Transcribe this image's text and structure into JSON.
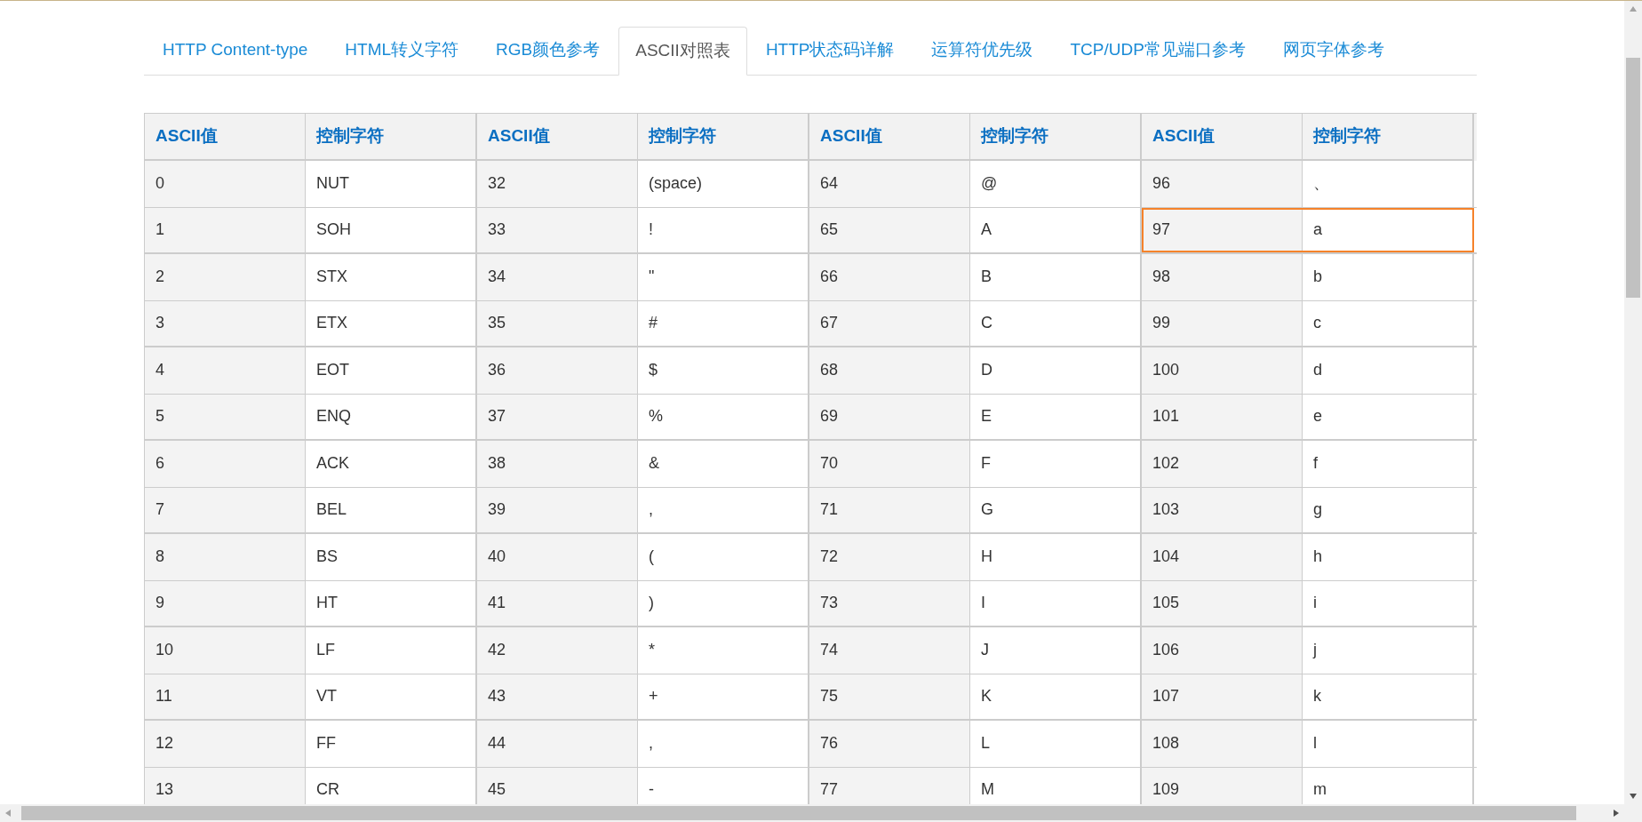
{
  "tabs": [
    {
      "label": "HTTP Content-type",
      "selected": false
    },
    {
      "label": "HTML转义字符",
      "selected": false
    },
    {
      "label": "RGB颜色参考",
      "selected": false
    },
    {
      "label": "ASCII对照表",
      "selected": true
    },
    {
      "label": "HTTP状态码详解",
      "selected": false
    },
    {
      "label": "运算符优先级",
      "selected": false
    },
    {
      "label": "TCP/UDP常见端口参考",
      "selected": false
    },
    {
      "label": "网页字体参考",
      "selected": false
    }
  ],
  "table": {
    "columns": [
      "ASCII值",
      "控制字符",
      "ASCII值",
      "控制字符",
      "ASCII值",
      "控制字符",
      "ASCII值",
      "控制字符"
    ],
    "rows": [
      {
        "groups": [
          {
            "code": "0",
            "char": "NUT",
            "highlighted": false
          },
          {
            "code": "32",
            "char": "(space)",
            "highlighted": false
          },
          {
            "code": "64",
            "char": "@",
            "highlighted": false
          },
          {
            "code": "96",
            "char": "、",
            "highlighted": false
          }
        ]
      },
      {
        "groups": [
          {
            "code": "1",
            "char": "SOH",
            "highlighted": false
          },
          {
            "code": "33",
            "char": "!",
            "highlighted": false
          },
          {
            "code": "65",
            "char": "A",
            "highlighted": false
          },
          {
            "code": "97",
            "char": "a",
            "highlighted": true
          }
        ]
      },
      {
        "groups": [
          {
            "code": "2",
            "char": "STX",
            "highlighted": false
          },
          {
            "code": "34",
            "char": "\"",
            "highlighted": false
          },
          {
            "code": "66",
            "char": "B",
            "highlighted": false
          },
          {
            "code": "98",
            "char": "b",
            "highlighted": false
          }
        ]
      },
      {
        "groups": [
          {
            "code": "3",
            "char": "ETX",
            "highlighted": false
          },
          {
            "code": "35",
            "char": "#",
            "highlighted": false
          },
          {
            "code": "67",
            "char": "C",
            "highlighted": false
          },
          {
            "code": "99",
            "char": "c",
            "highlighted": false
          }
        ]
      },
      {
        "groups": [
          {
            "code": "4",
            "char": "EOT",
            "highlighted": false
          },
          {
            "code": "36",
            "char": "$",
            "highlighted": false
          },
          {
            "code": "68",
            "char": "D",
            "highlighted": false
          },
          {
            "code": "100",
            "char": "d",
            "highlighted": false
          }
        ]
      },
      {
        "groups": [
          {
            "code": "5",
            "char": "ENQ",
            "highlighted": false
          },
          {
            "code": "37",
            "char": "%",
            "highlighted": false
          },
          {
            "code": "69",
            "char": "E",
            "highlighted": false
          },
          {
            "code": "101",
            "char": "e",
            "highlighted": false
          }
        ]
      },
      {
        "groups": [
          {
            "code": "6",
            "char": "ACK",
            "highlighted": false
          },
          {
            "code": "38",
            "char": "&",
            "highlighted": false
          },
          {
            "code": "70",
            "char": "F",
            "highlighted": false
          },
          {
            "code": "102",
            "char": "f",
            "highlighted": false
          }
        ]
      },
      {
        "groups": [
          {
            "code": "7",
            "char": "BEL",
            "highlighted": false
          },
          {
            "code": "39",
            "char": ",",
            "highlighted": false
          },
          {
            "code": "71",
            "char": "G",
            "highlighted": false
          },
          {
            "code": "103",
            "char": "g",
            "highlighted": false
          }
        ]
      },
      {
        "groups": [
          {
            "code": "8",
            "char": "BS",
            "highlighted": false
          },
          {
            "code": "40",
            "char": "(",
            "highlighted": false
          },
          {
            "code": "72",
            "char": "H",
            "highlighted": false
          },
          {
            "code": "104",
            "char": "h",
            "highlighted": false
          }
        ]
      },
      {
        "groups": [
          {
            "code": "9",
            "char": "HT",
            "highlighted": false
          },
          {
            "code": "41",
            "char": ")",
            "highlighted": false
          },
          {
            "code": "73",
            "char": "I",
            "highlighted": false
          },
          {
            "code": "105",
            "char": "i",
            "highlighted": false
          }
        ]
      },
      {
        "groups": [
          {
            "code": "10",
            "char": "LF",
            "highlighted": false
          },
          {
            "code": "42",
            "char": "*",
            "highlighted": false
          },
          {
            "code": "74",
            "char": "J",
            "highlighted": false
          },
          {
            "code": "106",
            "char": "j",
            "highlighted": false
          }
        ]
      },
      {
        "groups": [
          {
            "code": "11",
            "char": "VT",
            "highlighted": false
          },
          {
            "code": "43",
            "char": "+",
            "highlighted": false
          },
          {
            "code": "75",
            "char": "K",
            "highlighted": false
          },
          {
            "code": "107",
            "char": "k",
            "highlighted": false
          }
        ]
      },
      {
        "groups": [
          {
            "code": "12",
            "char": "FF",
            "highlighted": false
          },
          {
            "code": "44",
            "char": ",",
            "highlighted": false
          },
          {
            "code": "76",
            "char": "L",
            "highlighted": false
          },
          {
            "code": "108",
            "char": "l",
            "highlighted": false
          }
        ]
      },
      {
        "groups": [
          {
            "code": "13",
            "char": "CR",
            "highlighted": false
          },
          {
            "code": "45",
            "char": "-",
            "highlighted": false
          },
          {
            "code": "77",
            "char": "M",
            "highlighted": false
          },
          {
            "code": "109",
            "char": "m",
            "highlighted": false
          }
        ]
      }
    ]
  }
}
